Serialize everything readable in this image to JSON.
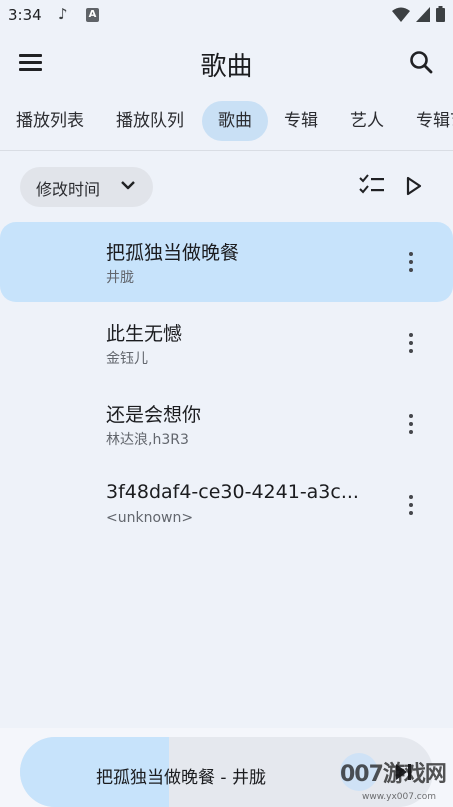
{
  "status": {
    "time": "3:34",
    "note_icon": "music-note-icon",
    "a_icon": "A"
  },
  "header": {
    "title": "歌曲"
  },
  "tabs": [
    {
      "label": "播放列表"
    },
    {
      "label": "播放队列"
    },
    {
      "label": "歌曲"
    },
    {
      "label": "专辑"
    },
    {
      "label": "艺人"
    },
    {
      "label": "专辑艺"
    }
  ],
  "active_tab": 2,
  "sort": {
    "label": "修改时间"
  },
  "songs": [
    {
      "title": "把孤独当做晚餐",
      "artist": "井胧",
      "playing": true
    },
    {
      "title": "此生无憾",
      "artist": "金钰儿",
      "playing": false
    },
    {
      "title": "还是会想你",
      "artist": "林达浪,h3R3",
      "playing": false
    },
    {
      "title": "3f48daf4-ce30-4241-a3c...",
      "artist": "<unknown>",
      "playing": false
    }
  ],
  "mini_player": {
    "text": "把孤独当做晚餐 - 井胧",
    "progress": 0.36
  },
  "watermark": {
    "text": "007游戏网",
    "url": "www.yx007.com"
  },
  "colors": {
    "accent": "#c7e3fb",
    "background": "#eef2f9"
  }
}
